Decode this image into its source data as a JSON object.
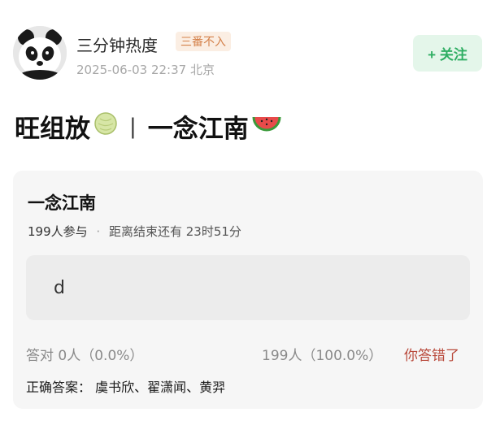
{
  "author": {
    "name": "三分钟热度",
    "tag": "三番不入",
    "timestamp": "2025-06-03 22:37",
    "location": "北京",
    "avatar_icon": "panda-avatar"
  },
  "follow_button": {
    "label": "+ 关注"
  },
  "post": {
    "title_left": "旺组放",
    "title_left_emoji": "melon-emoji",
    "separator": "|",
    "title_right": "一念江南",
    "title_right_emoji": "watermelon-emoji"
  },
  "quiz": {
    "title": "一念江南",
    "participants": "199人参与",
    "dot": "·",
    "deadline": "距离结束还有 23时51分",
    "answer": "d",
    "correct_label": "答对",
    "correct_stats": "0人（0.0%）",
    "wrong_stats": "199人（100.0%）",
    "wrong_label": "你答错了",
    "answer_key_label": "正确答案：",
    "answer_key": "虞书欣、翟潇闻、黄羿"
  },
  "colors": {
    "follow_bg": "#e4f6ea",
    "follow_text": "#2fae63",
    "tag_text": "#d4814a",
    "wrong_text": "#b94a3c"
  }
}
